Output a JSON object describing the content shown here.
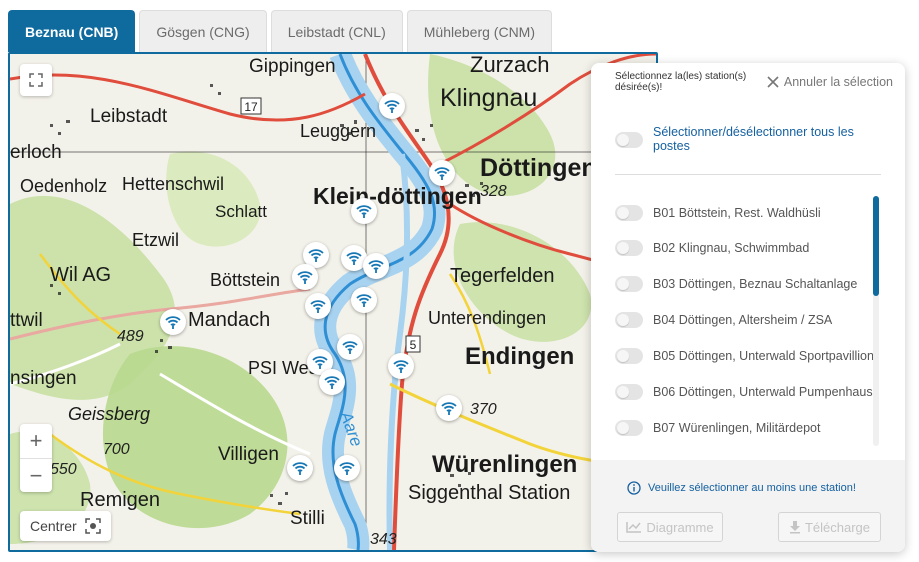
{
  "tabs": [
    {
      "label": "Beznau (CNB)",
      "active": true
    },
    {
      "label": "Gösgen (CNG)",
      "active": false
    },
    {
      "label": "Leibstadt (CNL)",
      "active": false
    },
    {
      "label": "Mühleberg (CNM)",
      "active": false
    }
  ],
  "map": {
    "places": [
      "Gippingen",
      "Zurzach",
      "Klingnau",
      "Leibstadt",
      "Leuggern",
      "erloch",
      "Döttingen",
      "Oedenholz",
      "Hettenschwil",
      "Klein-döttingen",
      "Schlatt",
      "Etzwil",
      "Wil AG",
      "Böttstein",
      "Tegerfelden",
      "ttwil",
      "Mandach",
      "Unterendingen",
      "Endingen",
      "PSI West",
      "nsingen",
      "Geissberg",
      "Aare",
      "Villigen",
      "Würenlingen",
      "Remigen",
      "Siggenthal Station",
      "Stilli"
    ],
    "road_numbers": [
      "17",
      "5"
    ],
    "elevations": [
      "328",
      "489",
      "370",
      "700",
      "550",
      "343"
    ],
    "controls": {
      "zoom_in": "+",
      "zoom_out": "−",
      "center_label": "Centrer"
    },
    "icons": {
      "fullscreen": "fullscreen-icon",
      "station": "wifi-station-icon",
      "center": "crosshair-icon"
    },
    "colors": {
      "water": "#a8d3f0",
      "river": "#5ca9de",
      "road_red": "#e04d3d",
      "road_yellow": "#f3d33a",
      "forest": "#c4df9f",
      "field": "#f3f2ea",
      "accent": "#0f6b9e"
    }
  },
  "panel": {
    "prompt": "Sélectionnez la(les) station(s) désirée(s)!",
    "cancel_label": "Annuler la sélection",
    "select_all_label": "Sélectionner/désélectionner tous les postes",
    "stations": [
      "B01 Böttstein, Rest. Waldhüsli",
      "B02 Klingnau, Schwimmbad",
      "B03 Döttingen, Beznau Schaltanlage",
      "B04 Döttingen, Altersheim / ZSA",
      "B05 Döttingen, Unterwald Sportpavillion",
      "B06 Döttingen, Unterwald Pumpenhaus",
      "B07 Würenlingen, Militärdepot"
    ],
    "warning": "Veuillez sélectionner au moins une station!",
    "diagram_label": "Diagramme",
    "download_label": "Télécharge",
    "icons": {
      "close": "close-icon",
      "info": "info-icon",
      "chart": "chart-icon",
      "download": "download-icon"
    }
  }
}
